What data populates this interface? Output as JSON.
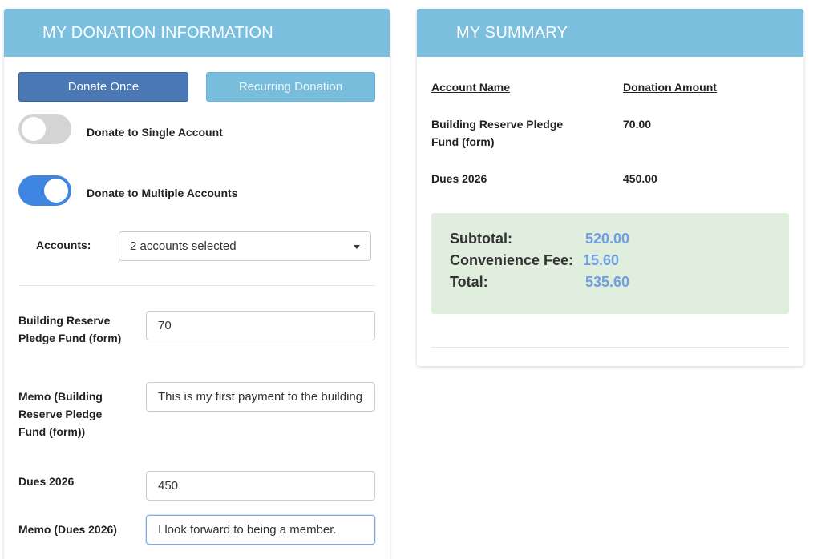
{
  "donation": {
    "title": "MY DONATION INFORMATION",
    "donate_once_label": "Donate Once",
    "recurring_label": "Recurring Donation",
    "single_account_label": "Donate to Single Account",
    "single_account_on": false,
    "multiple_accounts_label": "Donate to Multiple Accounts",
    "multiple_accounts_on": true,
    "accounts_label": "Accounts:",
    "accounts_selected": "2 accounts selected",
    "fields": [
      {
        "label": "Building Reserve Pledge Fund (form)",
        "value": "70"
      },
      {
        "label": "Memo (Building Reserve Pledge Fund (form))",
        "value": "This is my first payment to the building"
      },
      {
        "label": "Dues 2026",
        "value": "450"
      },
      {
        "label": "Memo (Dues 2026)",
        "value": "I look forward to being a member."
      }
    ]
  },
  "summary": {
    "title": "MY SUMMARY",
    "col_account": "Account Name",
    "col_amount": "Donation Amount",
    "rows": [
      {
        "name": "Building Reserve Pledge Fund (form)",
        "amount": "70.00"
      },
      {
        "name": "Dues 2026",
        "amount": "450.00"
      }
    ],
    "subtotal_label": "Subtotal:",
    "subtotal": "520.00",
    "fee_label": "Convenience Fee:",
    "fee": "15.60",
    "total_label": "Total:",
    "total": "535.60"
  },
  "colors": {
    "header": "#7bbedd",
    "primary_button": "#4a78b4",
    "toggle_on": "#3e86e2",
    "totals_bg": "#dfeedd",
    "totals_value": "#6f9ee2"
  }
}
